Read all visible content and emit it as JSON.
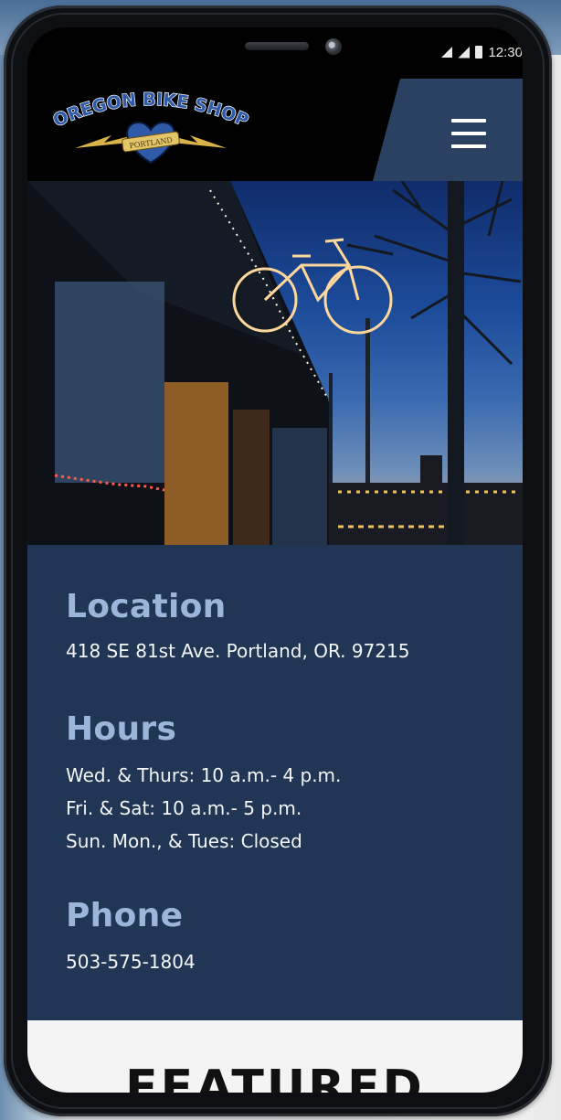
{
  "status_bar": {
    "time": "12:30"
  },
  "header": {
    "logo": {
      "name": "OREGON BIKE SHOP",
      "tagline": "PORTLAND"
    },
    "menu_icon": "hamburger-menu-icon"
  },
  "hero": {
    "image": "bike shop storefront at dusk with lit bicycle sign"
  },
  "info": {
    "location": {
      "heading": "Location",
      "address": "418 SE 81st Ave. Portland, OR. 97215"
    },
    "hours": {
      "heading": "Hours",
      "lines": [
        "Wed. & Thurs: 10 a.m.- 4 p.m.",
        "Fri. & Sat: 10 a.m.- 5 p.m.",
        "Sun. Mon., & Tues: Closed"
      ]
    },
    "phone": {
      "heading": "Phone",
      "number": "503-575-1804"
    }
  },
  "featured": {
    "title": "FEATURED"
  },
  "colors": {
    "info_bg": "#213654",
    "heading": "#9cb6db",
    "menu_panel": "#2b4161",
    "logo_blue": "#2f5aa8",
    "logo_gold": "#d9b24a"
  }
}
